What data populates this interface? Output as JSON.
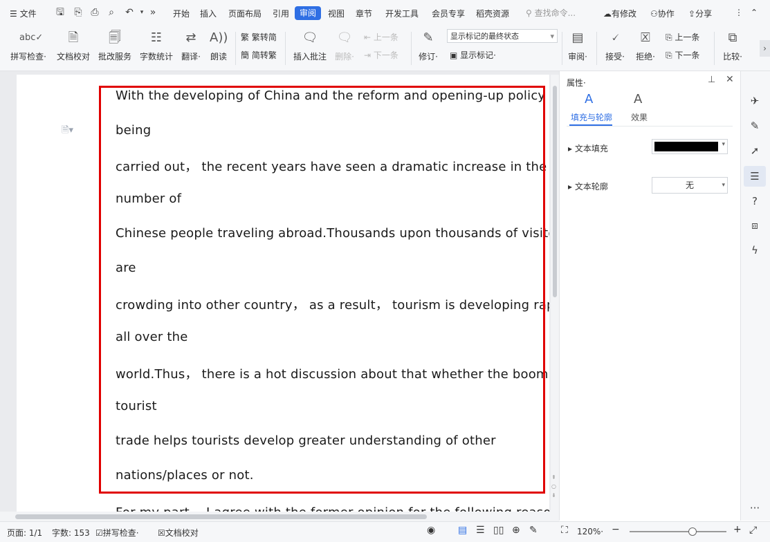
{
  "menu": {
    "hamburger_label": "文件",
    "tabs": [
      "开始",
      "插入",
      "页面布局",
      "引用",
      "审阅",
      "视图",
      "章节",
      "开发工具",
      "会员专享",
      "稻壳资源"
    ],
    "active_tab": "审阅",
    "search_placeholder": "查找命令...",
    "right": {
      "modified": "有修改",
      "collaborate": "协作",
      "share": "分享"
    }
  },
  "ribbon": {
    "spell_check": "拼写检查·",
    "doc_proof": "文档校对",
    "revise_service": "批改服务",
    "word_count": "字数统计",
    "translate": "翻译·",
    "read_aloud": "朗读",
    "trad_to_simp": "繁转简",
    "simp_to_trad": "简转繁",
    "insert_comment": "插入批注",
    "delete": "删除·",
    "prev_item": "上一条",
    "next_item": "下一条",
    "track_changes": "修订·",
    "markup_state": "显示标记的最终状态",
    "show_markup": "显示标记·",
    "review": "审阅·",
    "accept": "接受·",
    "reject": "拒绝·",
    "prev_change": "上一条",
    "next_change": "下一条",
    "compare": "比较·"
  },
  "document": {
    "lines": [
      "With the developing of China and the reform and opening-up policy",
      "being",
      "carried out，  the recent years have seen a dramatic increase in the",
      "number of",
      "Chinese people traveling abroad.Thousands upon thousands of visitors",
      "are",
      "crowding into other country，  as a result，  tourism is developing rapidly",
      "all over the",
      "world.Thus，  there is a hot discussion about that whether the booming",
      "tourist",
      "trade helps tourists develop greater understanding of other",
      "nations/places or not.",
      "For my part，  I agree with the former opinion for the following reasons"
    ]
  },
  "panel": {
    "title": "属性·",
    "tab_fill_outline": "填充与轮廓",
    "tab_effects": "效果",
    "text_fill_label": "文本填充",
    "text_fill_color": "#000000",
    "text_outline_label": "文本轮廓",
    "text_outline_value": "无"
  },
  "status": {
    "page": "页面: 1/1",
    "word_count": "字数: 153",
    "spell_check": "拼写检查·",
    "doc_proof": "文档校对",
    "zoom": "120%·",
    "zoom_level": 0.65
  },
  "colors": {
    "accent": "#2f6fe4",
    "highlight_box": "#e00000"
  }
}
